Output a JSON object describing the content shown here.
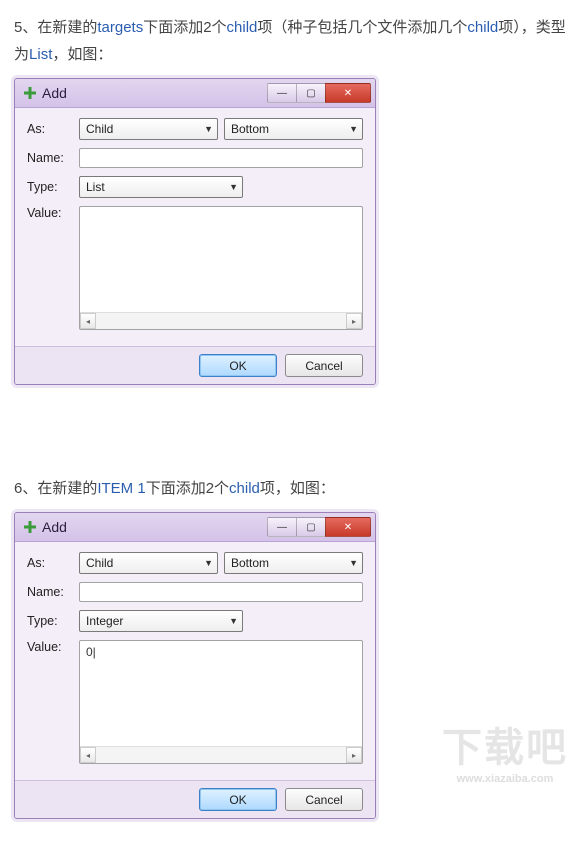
{
  "step5": {
    "text_prefix": "5、在新建的",
    "text_targets": "targets",
    "text_mid1": "下面添加2个",
    "text_child": "child",
    "text_mid2": "项（种子包括几个文件添加几个",
    "text_mid3": "项），类型为",
    "text_list": "List",
    "text_suffix": "，如图："
  },
  "step6": {
    "text_prefix": "6、在新建的",
    "text_item": "ITEM 1",
    "text_mid": "下面添加2个",
    "text_child": "child",
    "text_suffix": "项，如图："
  },
  "dialog1": {
    "title": "Add",
    "labels": {
      "as": "As:",
      "name": "Name:",
      "type": "Type:",
      "value": "Value:"
    },
    "as_value": "Child",
    "position_value": "Bottom",
    "name_value": "",
    "type_value": "List",
    "value_value": "",
    "ok": "OK",
    "cancel": "Cancel"
  },
  "dialog2": {
    "title": "Add",
    "labels": {
      "as": "As:",
      "name": "Name:",
      "type": "Type:",
      "value": "Value:"
    },
    "as_value": "Child",
    "position_value": "Bottom",
    "name_value": "",
    "type_value": "Integer",
    "value_value": "0|",
    "ok": "OK",
    "cancel": "Cancel"
  },
  "watermark": {
    "main": "下载吧",
    "sub": "www.xiazaiba.com"
  }
}
